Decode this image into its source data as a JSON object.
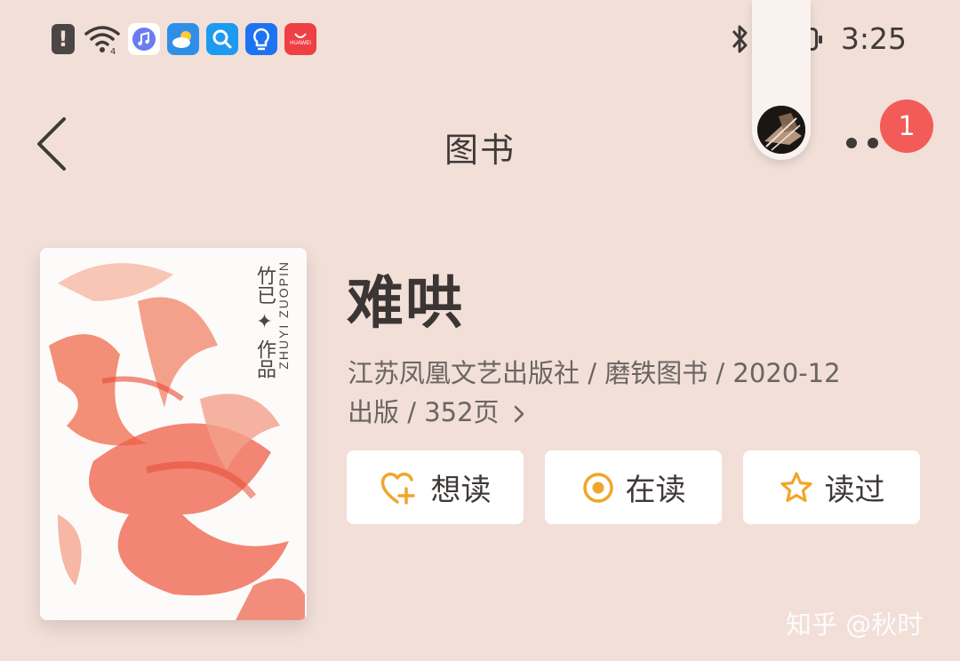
{
  "status_bar": {
    "time": "3:25",
    "icons": [
      "alert-icon",
      "wifi-icon",
      "music-app-icon",
      "weather-app-icon",
      "search-app-icon",
      "tips-app-icon",
      "huawei-store-icon",
      "bluetooth-icon",
      "battery-icon"
    ],
    "store_label": "HUAWEI"
  },
  "nav": {
    "title": "图书",
    "notification_count": "1"
  },
  "book": {
    "title": "难哄",
    "meta_line1": "江苏凤凰文艺出版社 / 磨铁图书 / 2020-12",
    "meta_line2": "出版 / 352页",
    "cover": {
      "author_line": "竹已 ✦ 作品",
      "pinyin_line": "ZHUYI ZUOPIN"
    }
  },
  "actions": [
    {
      "label": "想读",
      "icon": "heart-plus-icon"
    },
    {
      "label": "在读",
      "icon": "reading-dot-icon"
    },
    {
      "label": "读过",
      "icon": "star-icon"
    }
  ],
  "watermark": "知乎 @秋时",
  "colors": {
    "background": "#F1DFD8",
    "accent": "#F0A62A",
    "badge": "#F25B57",
    "text": "#3f3a38"
  }
}
